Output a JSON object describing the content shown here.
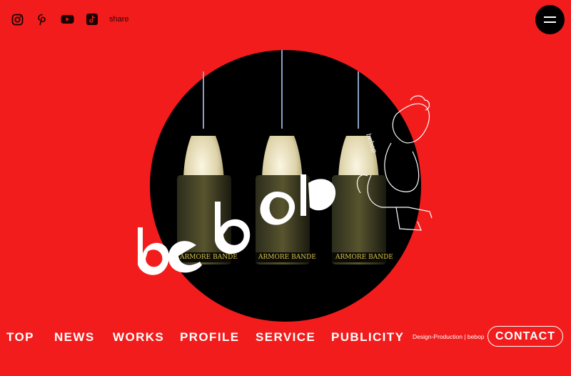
{
  "social": {
    "icons": [
      "instagram-icon",
      "pinterest-icon",
      "youtube-icon",
      "tiktok-icon"
    ],
    "share_label": "share"
  },
  "hero": {
    "logo_text": "bebop",
    "can_label": "ARMORE BANDE"
  },
  "nav": {
    "items": [
      "TOP",
      "NEWS",
      "WORKS",
      "PROFILE",
      "SERVICE",
      "PUBLICITY"
    ],
    "tagline": "Design-Production | bebop",
    "contact_label": "CONTACT"
  },
  "colors": {
    "background": "#f21c1c",
    "circle": "#000000",
    "text": "#ffffff"
  }
}
